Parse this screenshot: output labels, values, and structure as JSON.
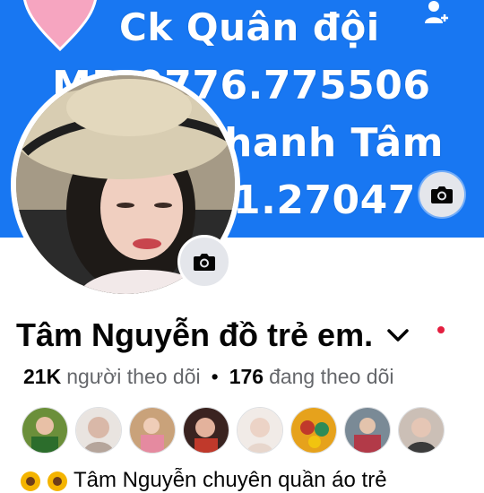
{
  "cover": {
    "lines": [
      "Ck Quân đội",
      "MB 0776.775506",
      "hanh Tâm",
      "1.27047"
    ],
    "accent": "#1877f2",
    "top_icon": "profile-icon",
    "camera_icon": "camera-icon"
  },
  "profile": {
    "name": "Tâm Nguyễn đồ trẻ em.",
    "dropdown_icon": "chevron-down-icon",
    "notification_dot_color": "#e41e3f",
    "camera_icon": "camera-icon"
  },
  "stats": {
    "followers_count": "21K",
    "followers_label": "người theo dõi",
    "separator": "•",
    "following_count": "176",
    "following_label": "đang theo dõi"
  },
  "friends": {
    "count_shown": 8
  },
  "bio": {
    "text": "Tâm Nguyễn chuyên quần áo trẻ",
    "icons": [
      "sunflower-icon",
      "sunflower-icon"
    ]
  }
}
